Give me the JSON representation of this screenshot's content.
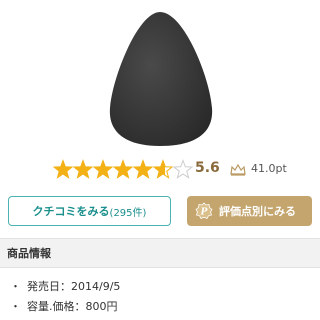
{
  "product": {
    "image_desc_icon": "sponge-image",
    "rating": 5.6,
    "rating_label": "5.6",
    "stars_total": 7,
    "points_label": "41.0pt"
  },
  "buttons": {
    "reviews_label": "クチコミをみる",
    "reviews_count": "(295件)",
    "rate_label": "評価点別にみる"
  },
  "section": {
    "title": "商品情報"
  },
  "info": [
    {
      "bullet": "・",
      "text": "発売日：2014/9/5"
    },
    {
      "bullet": "・",
      "text": "容量.価格：800円"
    }
  ],
  "colors": {
    "star_fill": "#f3b116",
    "star_empty": "#cccccc",
    "teal": "#4cb3b0",
    "gold": "#c4a56e"
  }
}
